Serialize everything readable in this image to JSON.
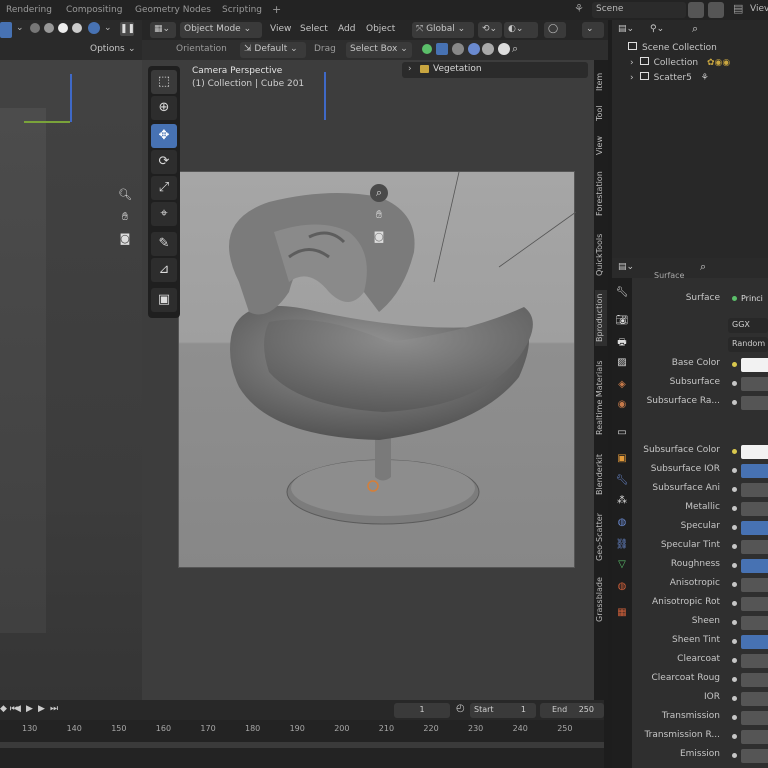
{
  "topbar": {
    "tabs": [
      "Rendering",
      "Compositing",
      "Geometry Nodes",
      "Scripting"
    ],
    "add_tab": "+",
    "scene_label": "Scene",
    "view_layer_label": "Viev"
  },
  "left_view": {
    "options_label": "Options"
  },
  "viewport_header": {
    "mode": "Object Mode",
    "menus": [
      "View",
      "Select",
      "Add",
      "Object"
    ],
    "transform": "Global",
    "orientation_label": "Orientation",
    "orientation_value": "Default",
    "drag_label": "Drag",
    "drag_value": "Select Box"
  },
  "viewport": {
    "camera_title": "Camera Perspective",
    "camera_sub": "(1) Collection | Cube 201",
    "collection_popup": "Vegetation"
  },
  "side_tabs": [
    "Item",
    "Tool",
    "View",
    "Forestation",
    "QuickTools",
    "Bproduction",
    "Realtime Materials",
    "Blenderkit",
    "Geo-Scatter",
    "Grassblade"
  ],
  "outliner": {
    "rows": [
      "Scene Collection",
      "Collection",
      "Scatter5"
    ]
  },
  "properties": {
    "section_partial": "Surface",
    "surface_label": "Surface",
    "surface_value": "Princi",
    "distribution": "GGX",
    "subsurface_method": "Random",
    "params": [
      {
        "label": "Base Color",
        "kind": "white"
      },
      {
        "label": "Subsurface",
        "kind": "gray"
      },
      {
        "label": "Subsurface Ra...",
        "kind": "gray"
      },
      {
        "label": "Subsurface Color",
        "kind": "white"
      },
      {
        "label": "Subsurface IOR",
        "kind": "blue"
      },
      {
        "label": "Subsurface Ani",
        "kind": "gray"
      },
      {
        "label": "Metallic",
        "kind": "gray"
      },
      {
        "label": "Specular",
        "kind": "blue"
      },
      {
        "label": "Specular Tint",
        "kind": "gray"
      },
      {
        "label": "Roughness",
        "kind": "blue"
      },
      {
        "label": "Anisotropic",
        "kind": "gray"
      },
      {
        "label": "Anisotropic Rot",
        "kind": "gray"
      },
      {
        "label": "Sheen",
        "kind": "gray"
      },
      {
        "label": "Sheen Tint",
        "kind": "blue"
      },
      {
        "label": "Clearcoat",
        "kind": "gray"
      },
      {
        "label": "Clearcoat Roug",
        "kind": "gray"
      },
      {
        "label": "IOR",
        "kind": "gray"
      },
      {
        "label": "Transmission",
        "kind": "gray"
      },
      {
        "label": "Transmission R...",
        "kind": "gray"
      },
      {
        "label": "Emission",
        "kind": "gray"
      }
    ]
  },
  "timeline": {
    "current_frame": "1",
    "start_label": "Start",
    "start_value": "1",
    "end_label": "End",
    "end_value": "250",
    "ticks": [
      "130",
      "140",
      "150",
      "160",
      "170",
      "180",
      "190",
      "200",
      "210",
      "220",
      "230",
      "240",
      "250"
    ]
  },
  "colors": {
    "accent": "#4772b3",
    "bg": "#1d1d1d",
    "panel": "#2f2f2f"
  }
}
